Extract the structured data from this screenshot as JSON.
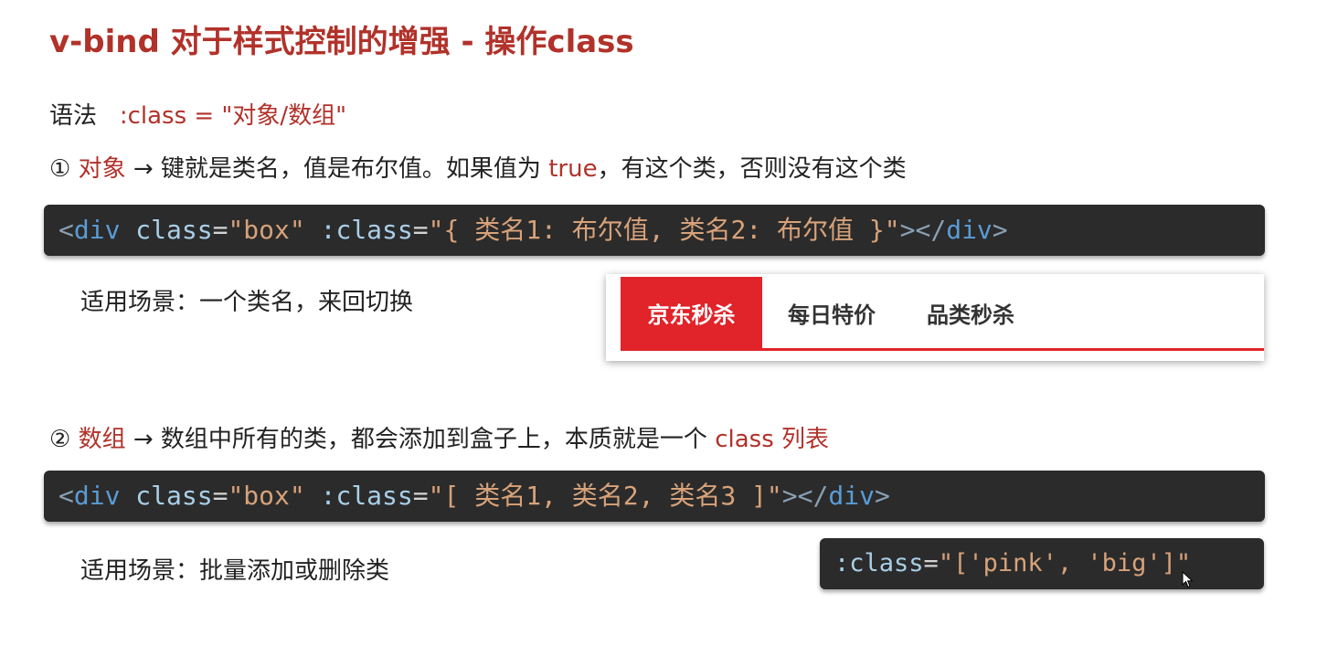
{
  "title": "v-bind 对于样式控制的增强 - 操作class",
  "syntax": {
    "label": "语法",
    "value": ":class = \"对象/数组\""
  },
  "object_section": {
    "number": "①",
    "keyword": "对象",
    "arrow": "→",
    "text_before": "键就是类名，值是布尔值。如果值为",
    "true_word": "true",
    "text_after": "，有这个类，否则没有这个类",
    "code": {
      "open_bracket": "<",
      "tag": "div",
      "attr1": "class",
      "eq1": "=",
      "val1": "\"box\"",
      "attr2": ":class",
      "eq2": "=",
      "val2": "\"{ 类名1: 布尔值, 类名2: 布尔值 }\"",
      "close_open": "></",
      "close_tag": "div",
      "close_bracket": ">"
    },
    "scene": "适用场景：一个类名，来回切换",
    "tabs": [
      "京东秒杀",
      "每日特价",
      "品类秒杀"
    ]
  },
  "array_section": {
    "number": "②",
    "keyword": "数组",
    "arrow": "→",
    "text_before": "数组中所有的类，都会添加到盒子上，本质就是一个",
    "class_list": "class 列表",
    "code": {
      "open_bracket": "<",
      "tag": "div",
      "attr1": "class",
      "eq1": "=",
      "val1": "\"box\"",
      "attr2": ":class",
      "eq2": "=",
      "val2": "\"[ 类名1, 类名2, 类名3 ]\"",
      "close_open": "></",
      "close_tag": "div",
      "close_bracket": ">"
    },
    "scene": "适用场景：批量添加或删除类",
    "example": {
      "attr": ":class",
      "eq": "=",
      "val": "\"['pink', 'big']\""
    }
  },
  "colors": {
    "accent_red": "#b1322a",
    "tab_red": "#e0242a",
    "code_bg": "#2b2b2b"
  }
}
